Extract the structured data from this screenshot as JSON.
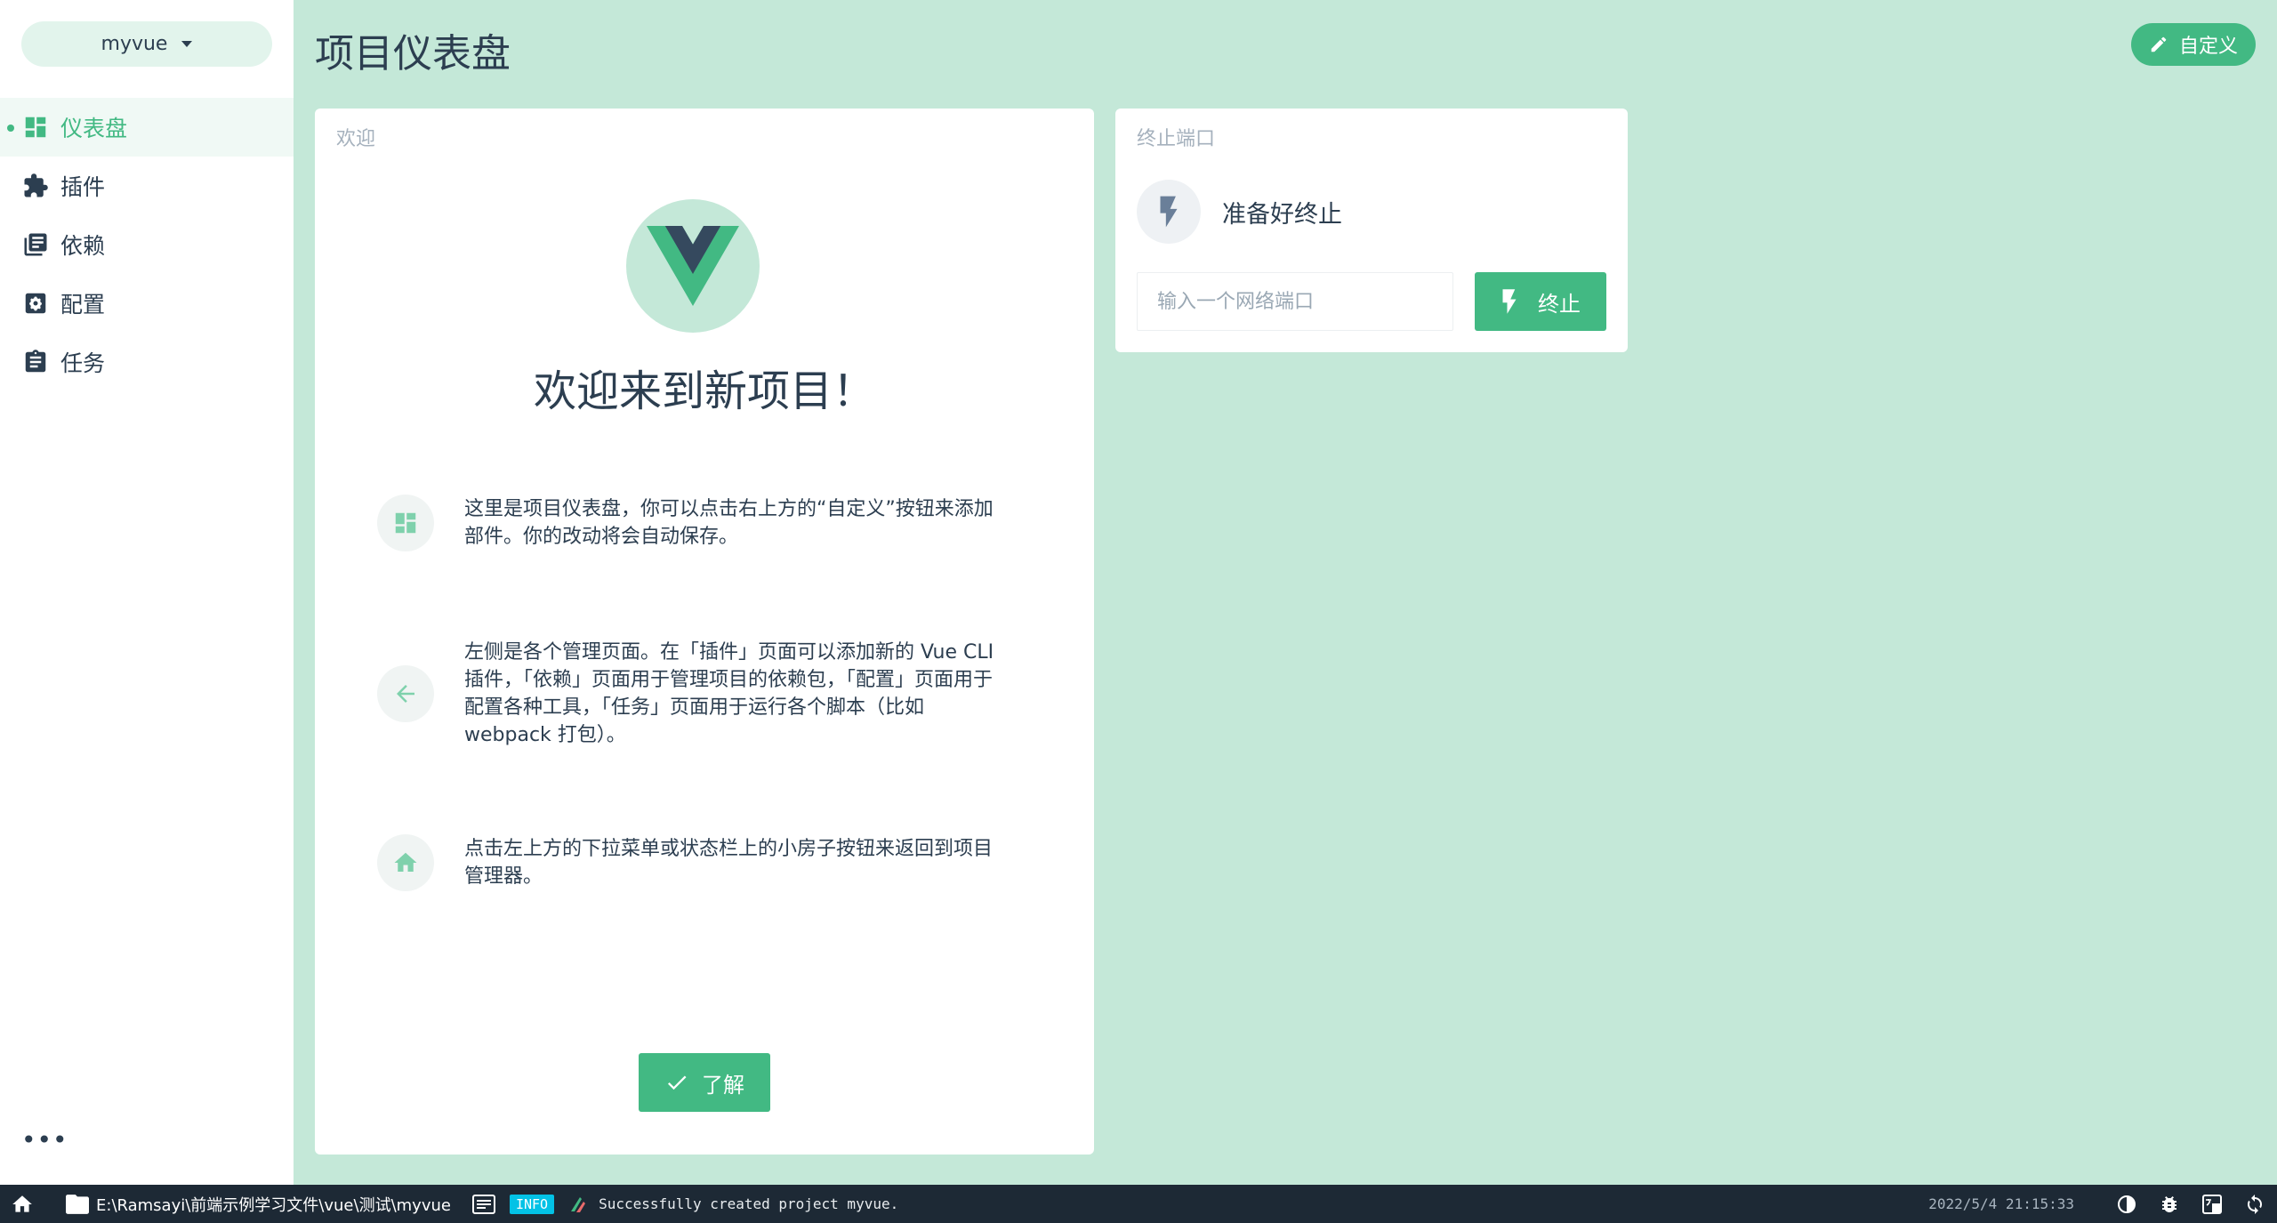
{
  "sidebar": {
    "project_name": "myvue",
    "items": [
      {
        "label": "仪表盘",
        "icon": "dashboard-icon",
        "active": true
      },
      {
        "label": "插件",
        "icon": "puzzle-icon",
        "active": false
      },
      {
        "label": "依赖",
        "icon": "library-books-icon",
        "active": false
      },
      {
        "label": "配置",
        "icon": "settings-icon",
        "active": false
      },
      {
        "label": "任务",
        "icon": "clipboard-icon",
        "active": false
      }
    ],
    "more_label": "•••"
  },
  "header": {
    "title": "项目仪表盘",
    "customize_label": "自定义"
  },
  "welcome": {
    "card_title": "欢迎",
    "heading": "欢迎来到新项目！",
    "tips": [
      {
        "icon": "dashboard-icon",
        "text": "这里是项目仪表盘，你可以点击右上方的“自定义”按钮来添加部件。你的改动将会自动保存。"
      },
      {
        "icon": "arrow-left-icon",
        "text": "左侧是各个管理页面。在「插件」页面可以添加新的 Vue CLI 插件，「依赖」页面用于管理项目的依赖包，「配置」页面用于配置各种工具，「任务」页面用于运行各个脚本（比如 webpack 打包）。"
      },
      {
        "icon": "home-icon",
        "text": "点击左上方的下拉菜单或状态栏上的小房子按钮来返回到项目管理器。"
      }
    ],
    "ok_label": "了解"
  },
  "kill_port": {
    "card_title": "终止端口",
    "status_text": "准备好终止",
    "input_placeholder": "输入一个网络端口",
    "input_value": "",
    "kill_label": "终止"
  },
  "statusbar": {
    "path": "E:\\Ramsayi\\前端示例学习文件\\vue\\测试\\myvue",
    "log_level": "INFO",
    "log_message": "Successfully created project myvue.",
    "timestamp": "2022/5/4  21:15:33"
  },
  "colors": {
    "accent": "#42b983",
    "page_bg": "#c4e8d8",
    "statusbar_bg": "#1d2935",
    "info_badge": "#03c2e6",
    "vue_dark": "#35495e"
  }
}
